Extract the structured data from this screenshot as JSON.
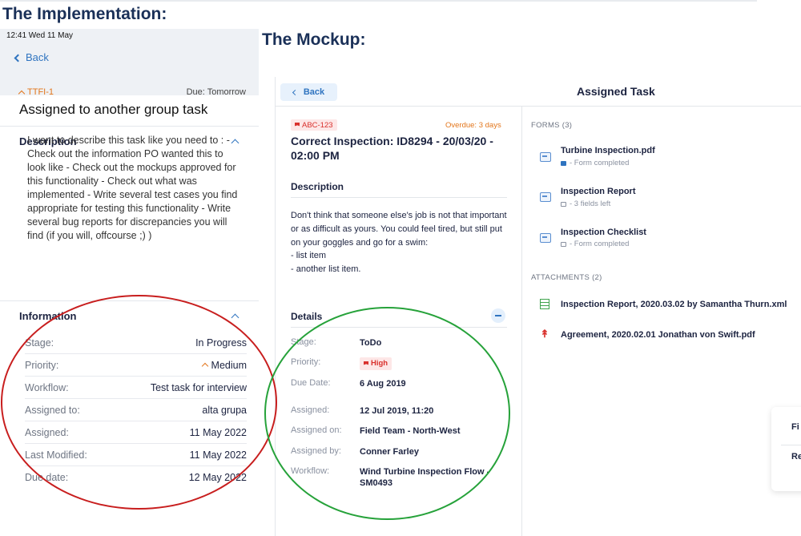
{
  "headings": {
    "implementation": "The Implementation:",
    "mockup": "The Mockup:"
  },
  "implementation": {
    "status_time": "12:41  Wed 11 May",
    "back_label": "Back",
    "task_id": "TTFI-1",
    "due": "Due: Tomorrow",
    "title": "Assigned to another group task",
    "description_heading": "Description",
    "description_text": "I want to describe this task like you need to : - Check out the information PO wanted this to look like  - Check out the mockups approved for this functionality - Check out what was implemented  - Write several test cases you find appropriate for testing this functionality - Write several bug reports for discrepancies you will find (if you will, offcourse ;) )",
    "information_heading": "Information",
    "info_rows": [
      {
        "label": "Stage:",
        "value": "In Progress"
      },
      {
        "label": "Priority:",
        "value": "Medium"
      },
      {
        "label": "Workflow:",
        "value": "Test task for interview"
      },
      {
        "label": "Assigned to:",
        "value": "alta grupa"
      },
      {
        "label": "Assigned:",
        "value": "11 May 2022"
      },
      {
        "label": "Last Modified:",
        "value": "11 May 2022"
      },
      {
        "label": "Due date:",
        "value": "12 May 2022"
      }
    ]
  },
  "mockup": {
    "back_label": "Back",
    "header_title": "Assigned Task",
    "task_id": "ABC-123",
    "overdue": "Overdue: 3 days",
    "title": "Correct Inspection: ID8294 - 20/03/20 - 02:00 PM",
    "description_heading": "Description",
    "description_text": "Don't think that someone else's job is not that important or as difficult as yours. You could feel tired, but still put on your goggles and go for a swim:",
    "description_list": [
      "- list item",
      "- another list item."
    ],
    "details_heading": "Details",
    "details_rows": [
      {
        "label": "Stage:",
        "value": "ToDo"
      },
      {
        "label": "Priority:",
        "value": "High"
      },
      {
        "label": "Due Date:",
        "value": "6 Aug 2019"
      },
      {
        "label": "Assigned:",
        "value": "12 Jul 2019, 11:20"
      },
      {
        "label": "Assigned on:",
        "value": "Field Team - North-West"
      },
      {
        "label": "Assigned by:",
        "value": "Conner Farley"
      },
      {
        "label": "Workflow:",
        "value": "Wind Turbine Inspection Flow - SM0493"
      }
    ],
    "forms_heading": "FORMS (3)",
    "forms": [
      {
        "name": "Turbine Inspection.pdf",
        "status": "- Form completed"
      },
      {
        "name": "Inspection Report",
        "status": "- 3 fields left"
      },
      {
        "name": "Inspection Checklist",
        "status": "- Form completed"
      }
    ],
    "attachments_heading": "ATTACHMENTS (2)",
    "attachments": [
      {
        "name": "Inspection Report, 2020.03.02 by Samantha Thurn.xml"
      },
      {
        "name": "Agreement, 2020.02.01 Jonathan von Swift.pdf"
      }
    ],
    "popup_options": [
      "Fi",
      "Re"
    ]
  }
}
